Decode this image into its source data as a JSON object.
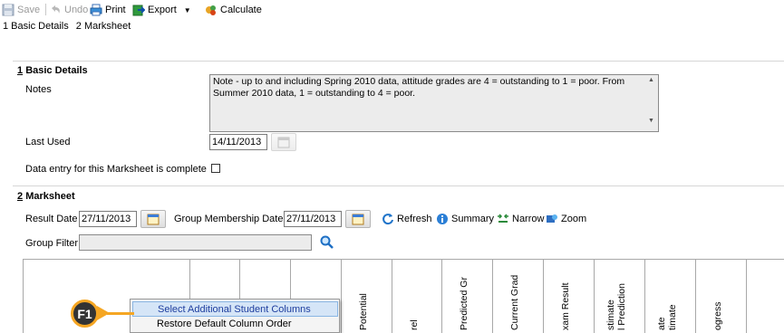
{
  "toolbar": {
    "save": "Save",
    "undo": "Undo",
    "print": "Print",
    "export": "Export",
    "calculate": "Calculate"
  },
  "nav": {
    "basic_details": "1 Basic Details",
    "marksheet": "2 Marksheet"
  },
  "basic_details": {
    "section_num": "1",
    "section_title": "Basic Details",
    "notes_label": "Notes",
    "notes_value": "Note - up to and including Spring 2010 data, attitude grades are 4 = outstanding to 1 = poor. From Summer 2010 data, 1 = outstanding to 4 = poor.",
    "last_used_label": "Last Used",
    "last_used_value": "14/11/2013",
    "complete_label": "Data entry for this Marksheet is complete",
    "complete_checked": false
  },
  "marksheet": {
    "section_num": "2",
    "section_title": "Marksheet",
    "result_date_label": "Result Date",
    "result_date_value": "27/11/2013",
    "group_membership_label": "Group Membership Date",
    "group_membership_value": "27/11/2013",
    "refresh": "Refresh",
    "summary": "Summary",
    "narrow": "Narrow",
    "zoom": "Zoom",
    "group_filter_label": "Group Filter",
    "group_filter_value": ""
  },
  "grid": {
    "columns": [
      "",
      "",
      "",
      "",
      "Potential",
      "rel",
      "Predicted Gr",
      "Current Grad",
      "xam Result",
      "stimate",
      "l Prediction",
      "ate",
      "timate",
      "ogress"
    ]
  },
  "context_menu": {
    "item1": "Select Additional Student Columns",
    "item2": "Restore Default Column Order"
  },
  "badge": {
    "label": "F1"
  },
  "colors": {
    "badge_ring": "#f5a623",
    "menu_highlight": "#d5e5f7"
  }
}
